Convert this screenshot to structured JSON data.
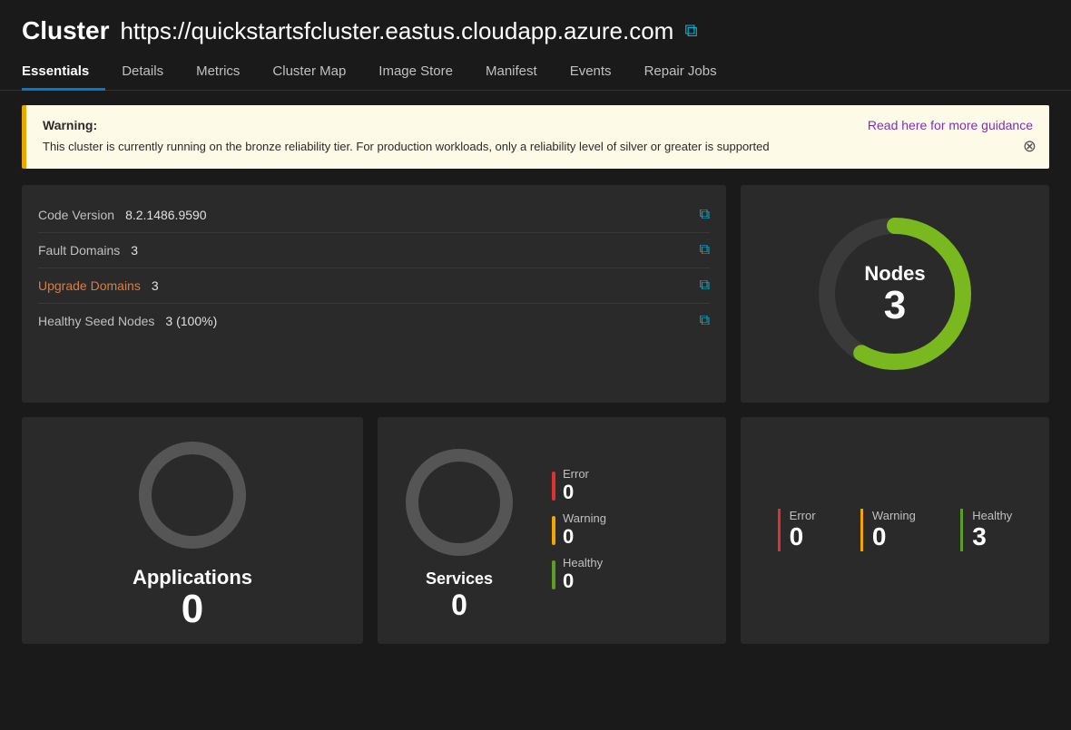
{
  "header": {
    "title": "Cluster",
    "url": "https://quickstartsfcluster.eastus.cloudapp.azure.com",
    "copy_icon": "⧉"
  },
  "nav": {
    "tabs": [
      {
        "label": "Essentials",
        "active": true
      },
      {
        "label": "Details",
        "active": false
      },
      {
        "label": "Metrics",
        "active": false
      },
      {
        "label": "Cluster Map",
        "active": false
      },
      {
        "label": "Image Store",
        "active": false
      },
      {
        "label": "Manifest",
        "active": false
      },
      {
        "label": "Events",
        "active": false
      },
      {
        "label": "Repair Jobs",
        "active": false
      }
    ]
  },
  "warning": {
    "label": "Warning:",
    "text": "This cluster is currently running on the bronze reliability tier. For production workloads, only a reliability level of silver or greater is supported",
    "link_text": "Read here for more guidance",
    "close_icon": "⊗"
  },
  "info_rows": [
    {
      "label": "Code Version",
      "value": "8.2.1486.9590",
      "orange": false
    },
    {
      "label": "Fault Domains",
      "value": "3",
      "orange": false
    },
    {
      "label": "Upgrade Domains",
      "value": "3",
      "orange": true
    },
    {
      "label": "Healthy Seed Nodes",
      "value": "3 (100%)",
      "orange": false
    }
  ],
  "nodes": {
    "label": "Nodes",
    "value": "3",
    "donut_color": "#7ab820",
    "donut_bg": "#3a3a3a"
  },
  "applications": {
    "label": "Applications",
    "value": "0"
  },
  "services": {
    "label": "Services",
    "value": "0",
    "statuses": [
      {
        "label": "Error",
        "value": "0",
        "color": "red"
      },
      {
        "label": "Warning",
        "value": "0",
        "color": "yellow"
      },
      {
        "label": "Healthy",
        "value": "0",
        "color": "green"
      }
    ]
  },
  "nodes_stats": [
    {
      "label": "Error",
      "value": "0",
      "type": "error"
    },
    {
      "label": "Warning",
      "value": "0",
      "type": "warning"
    },
    {
      "label": "Healthy",
      "value": "3",
      "type": "healthy"
    }
  ],
  "copy_icon_char": "⧉",
  "close_icon_char": "⊗"
}
